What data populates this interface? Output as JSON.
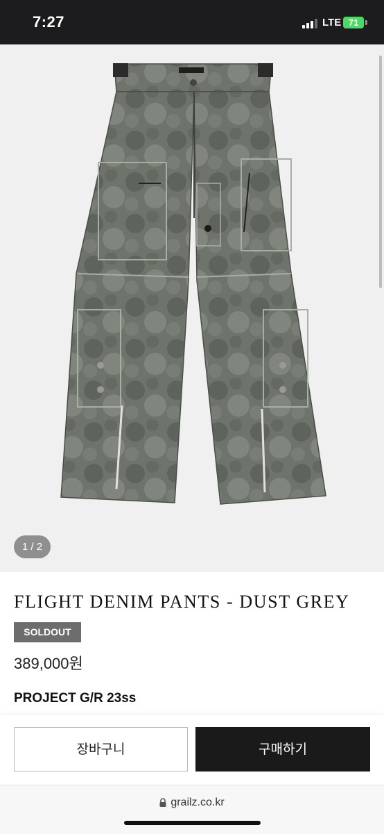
{
  "status_bar": {
    "time": "7:27",
    "network": "LTE",
    "battery": "71"
  },
  "gallery": {
    "counter": "1 / 2"
  },
  "product": {
    "title": "FLIGHT DENIM PANTS - DUST GREY",
    "status_badge": "SOLDOUT",
    "price": "389,000원",
    "brand_season": "PROJECT G/R 23ss"
  },
  "actions": {
    "cart_label": "장바구니",
    "buy_label": "구매하기"
  },
  "browser": {
    "url": "grailz.co.kr"
  },
  "colors": {
    "badge": "#6d6d6d",
    "buy_button": "#1a1a1a",
    "battery": "#4cd964"
  }
}
